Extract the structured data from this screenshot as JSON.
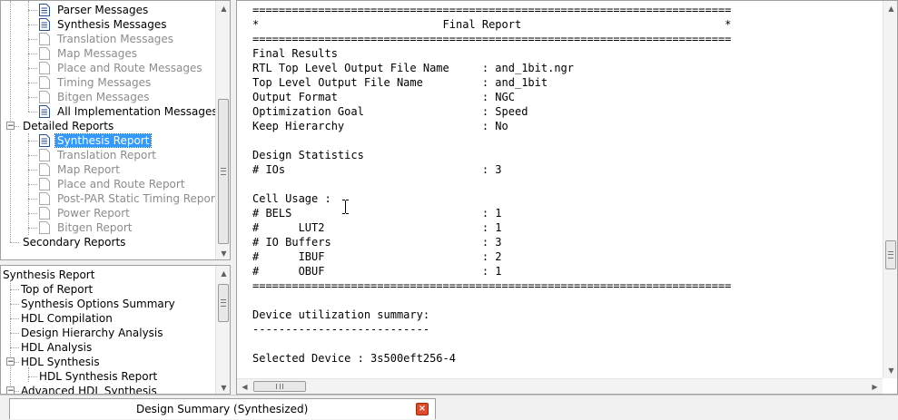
{
  "process_tree": {
    "items": [
      {
        "label": "Parser Messages",
        "state": "active",
        "level": 2
      },
      {
        "label": "Synthesis Messages",
        "state": "active",
        "level": 2
      },
      {
        "label": "Translation Messages",
        "state": "disabled",
        "level": 2
      },
      {
        "label": "Map Messages",
        "state": "disabled",
        "level": 2
      },
      {
        "label": "Place and Route Messages",
        "state": "disabled",
        "level": 2
      },
      {
        "label": "Timing Messages",
        "state": "disabled",
        "level": 2
      },
      {
        "label": "Bitgen Messages",
        "state": "disabled",
        "level": 2
      },
      {
        "label": "All Implementation Messages",
        "state": "active",
        "level": 2
      },
      {
        "label": "Detailed Reports",
        "state": "group",
        "level": 1
      },
      {
        "label": "Synthesis Report",
        "state": "selected",
        "level": 2
      },
      {
        "label": "Translation Report",
        "state": "disabled",
        "level": 2
      },
      {
        "label": "Map Report",
        "state": "disabled",
        "level": 2
      },
      {
        "label": "Place and Route Report",
        "state": "disabled",
        "level": 2
      },
      {
        "label": "Post-PAR Static Timing Report",
        "state": "disabled",
        "level": 2
      },
      {
        "label": "Power Report",
        "state": "disabled",
        "level": 2
      },
      {
        "label": "Bitgen Report",
        "state": "disabled",
        "level": 2
      },
      {
        "label": "Secondary Reports",
        "state": "group-leaf",
        "level": 1
      }
    ],
    "expander_minus": "−"
  },
  "outline_tree": {
    "items": [
      {
        "label": "Synthesis Report",
        "level": 0
      },
      {
        "label": "Top of Report",
        "level": 1
      },
      {
        "label": "Synthesis Options Summary",
        "level": 1
      },
      {
        "label": "HDL Compilation",
        "level": 1
      },
      {
        "label": "Design Hierarchy Analysis",
        "level": 1
      },
      {
        "label": "HDL Analysis",
        "level": 1
      },
      {
        "label": "HDL Synthesis",
        "level": 1,
        "expanded": true
      },
      {
        "label": "HDL Synthesis Report",
        "level": 2
      },
      {
        "label": "Advanced HDL Synthesis",
        "level": 1,
        "expanded": true
      }
    ]
  },
  "report": {
    "lines": [
      "=========================================================================",
      "*                            Final Report                               *",
      "=========================================================================",
      "Final Results",
      "RTL Top Level Output File Name     : and_1bit.ngr",
      "Top Level Output File Name         : and_1bit",
      "Output Format                      : NGC",
      "Optimization Goal                  : Speed",
      "Keep Hierarchy                     : No",
      "",
      "Design Statistics",
      "# IOs                              : 3",
      "",
      "Cell Usage :",
      "# BELS                             : 1",
      "#      LUT2                        : 1",
      "# IO Buffers                       : 3",
      "#      IBUF                        : 2",
      "#      OBUF                        : 1",
      "=========================================================================",
      "",
      "Device utilization summary:",
      "---------------------------",
      "",
      "Selected Device : 3s500eft256-4"
    ]
  },
  "tabs": [
    {
      "label": "Design Summary (Synthesized)",
      "close": "×"
    }
  ],
  "scroll_glyphs": {
    "up": "▲",
    "down": "▼",
    "left": "◀",
    "right": "▶"
  }
}
